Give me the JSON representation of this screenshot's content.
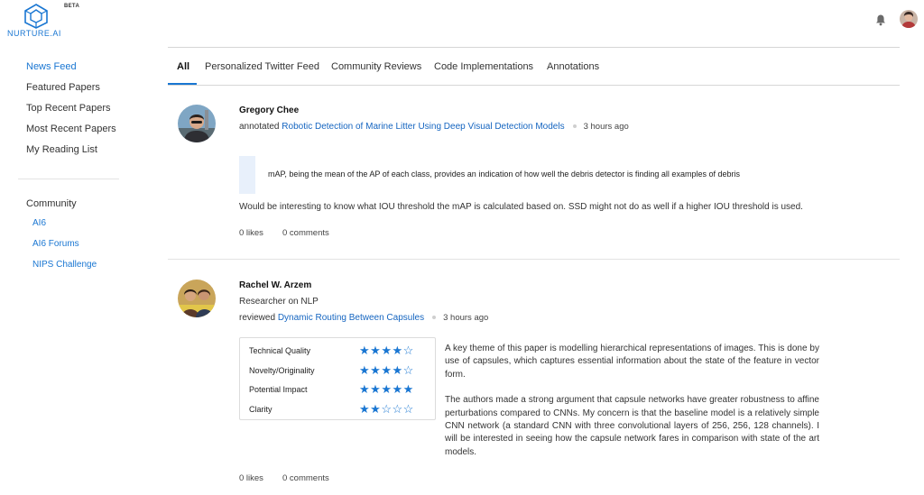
{
  "brand": {
    "name": "NURTURE.AI",
    "beta": "BETA",
    "accent": "#1976d2"
  },
  "header": {
    "bell_icon": "bell-icon",
    "avatar": "user-avatar"
  },
  "sidebar": {
    "items": [
      {
        "label": "News Feed",
        "active": true
      },
      {
        "label": "Featured Papers"
      },
      {
        "label": "Top Recent Papers"
      },
      {
        "label": "Most Recent Papers"
      },
      {
        "label": "My Reading List"
      }
    ],
    "community_heading": "Community",
    "community_items": [
      {
        "label": "AI6"
      },
      {
        "label": "AI6 Forums"
      },
      {
        "label": "NIPS Challenge"
      }
    ]
  },
  "tabs": [
    {
      "label": "All",
      "active": true
    },
    {
      "label": "Personalized Twitter Feed"
    },
    {
      "label": "Community Reviews"
    },
    {
      "label": "Code Implementations"
    },
    {
      "label": "Annotations"
    }
  ],
  "posts": [
    {
      "author": "Gregory Chee",
      "action": "annotated",
      "paper": "Robotic Detection of Marine Litter Using Deep Visual Detection Models",
      "time": "3 hours ago",
      "quote": "mAP, being the mean of the AP of each class, provides an indication of how well the debris detector is finding all examples of debris",
      "comment": "Would be interesting to know what IOU threshold the mAP is calculated based on. SSD might not do as well if a higher IOU threshold is used.",
      "likes": "0 likes",
      "comments": "0 comments"
    },
    {
      "author": "Rachel W. Arzem",
      "role": "Researcher on NLP",
      "action": "reviewed",
      "paper": "Dynamic Routing Between Capsules",
      "time": "3 hours ago",
      "ratings": [
        {
          "label": "Technical Quality",
          "stars": 4,
          "max": 5
        },
        {
          "label": "Novelty/Originality",
          "stars": 4,
          "max": 5
        },
        {
          "label": "Potential Impact",
          "stars": 5,
          "max": 5
        },
        {
          "label": "Clarity",
          "stars": 2,
          "max": 5
        }
      ],
      "review_p1": "A key theme of this paper is modelling hierarchical representations of images. This is done by use of capsules, which captures essential information about the state of the feature in vector form.",
      "review_p2": "The authors made a strong argument that capsule networks have greater robustness to affine perturbations compared to CNNs. My concern is that the baseline model is a relatively simple CNN network (a standard CNN with three convolutional layers of 256, 256, 128 channels). I will be interested in seeing how the capsule network fares in comparison with state of the art models.",
      "likes": "0 likes",
      "comments": "0 comments"
    }
  ]
}
